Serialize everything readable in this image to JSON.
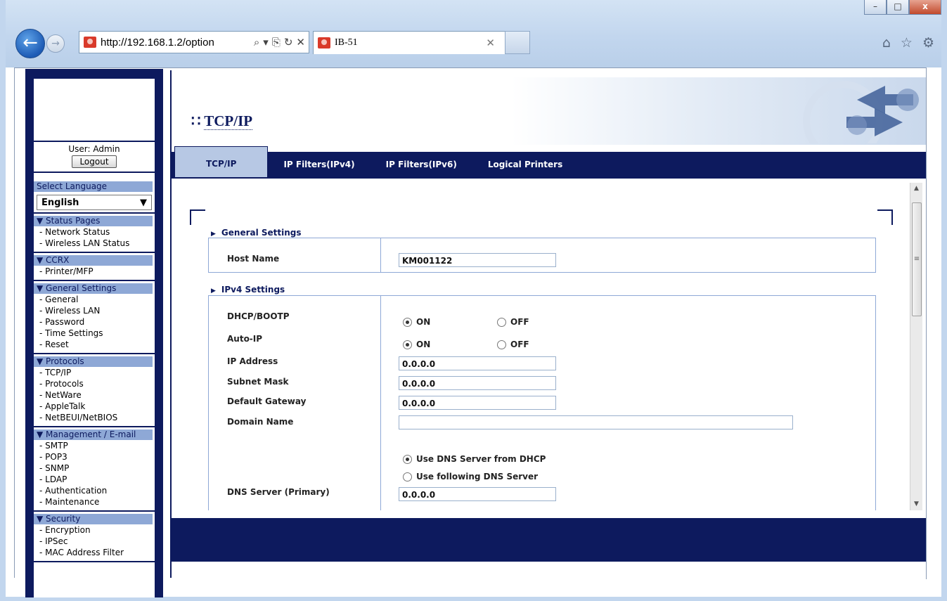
{
  "browser": {
    "url": "http://192.168.1.2/option",
    "tab_title": "IB-51",
    "back_icon": "←",
    "fwd_icon": "→",
    "min": "–",
    "max": "□",
    "close": "x"
  },
  "sidebar": {
    "user": "User: Admin",
    "logout": "Logout",
    "language_heading": "Select Language",
    "language_value": "English",
    "sections": [
      {
        "heading": "▼ Status Pages",
        "links": [
          "- Network Status",
          "- Wireless LAN Status"
        ]
      },
      {
        "heading": "▼ CCRX",
        "links": [
          "- Printer/MFP"
        ]
      },
      {
        "heading": "▼ General Settings",
        "links": [
          "- General",
          "- Wireless LAN",
          "- Password",
          "- Time Settings",
          "- Reset"
        ]
      },
      {
        "heading": "▼ Protocols",
        "links": [
          "- TCP/IP",
          "- Protocols",
          "- NetWare",
          "- AppleTalk",
          "- NetBEUI/NetBIOS"
        ]
      },
      {
        "heading": "▼ Management / E-mail",
        "links": [
          "- SMTP",
          "- POP3",
          "- SNMP",
          "- LDAP",
          "- Authentication",
          "- Maintenance"
        ]
      },
      {
        "heading": "▼ Security",
        "links": [
          "- Encryption",
          "- IPSec",
          "- MAC Address Filter"
        ]
      }
    ]
  },
  "main": {
    "title_icon": "∷",
    "title": "TCP/IP",
    "tabs": [
      "TCP/IP",
      "IP Filters(IPv4)",
      "IP Filters(IPv6)",
      "Logical Printers"
    ],
    "general_settings": {
      "heading": "General Settings",
      "host_name_label": "Host Name",
      "host_name_value": "KM001122"
    },
    "ipv4": {
      "heading": "IPv4 Settings",
      "dhcp_label": "DHCP/BOOTP",
      "autoip_label": "Auto-IP",
      "on": "ON",
      "off": "OFF",
      "ip_label": "IP Address",
      "ip_value": "0.0.0.0",
      "subnet_label": "Subnet Mask",
      "subnet_value": "0.0.0.0",
      "gateway_label": "Default Gateway",
      "gateway_value": "0.0.0.0",
      "domain_label": "Domain Name",
      "domain_value": "",
      "dns_dhcp": "Use DNS Server from DHCP",
      "dns_manual": "Use following DNS Server",
      "dns_primary_label": "DNS Server (Primary)",
      "dns_primary_value": "0.0.0.0"
    }
  }
}
